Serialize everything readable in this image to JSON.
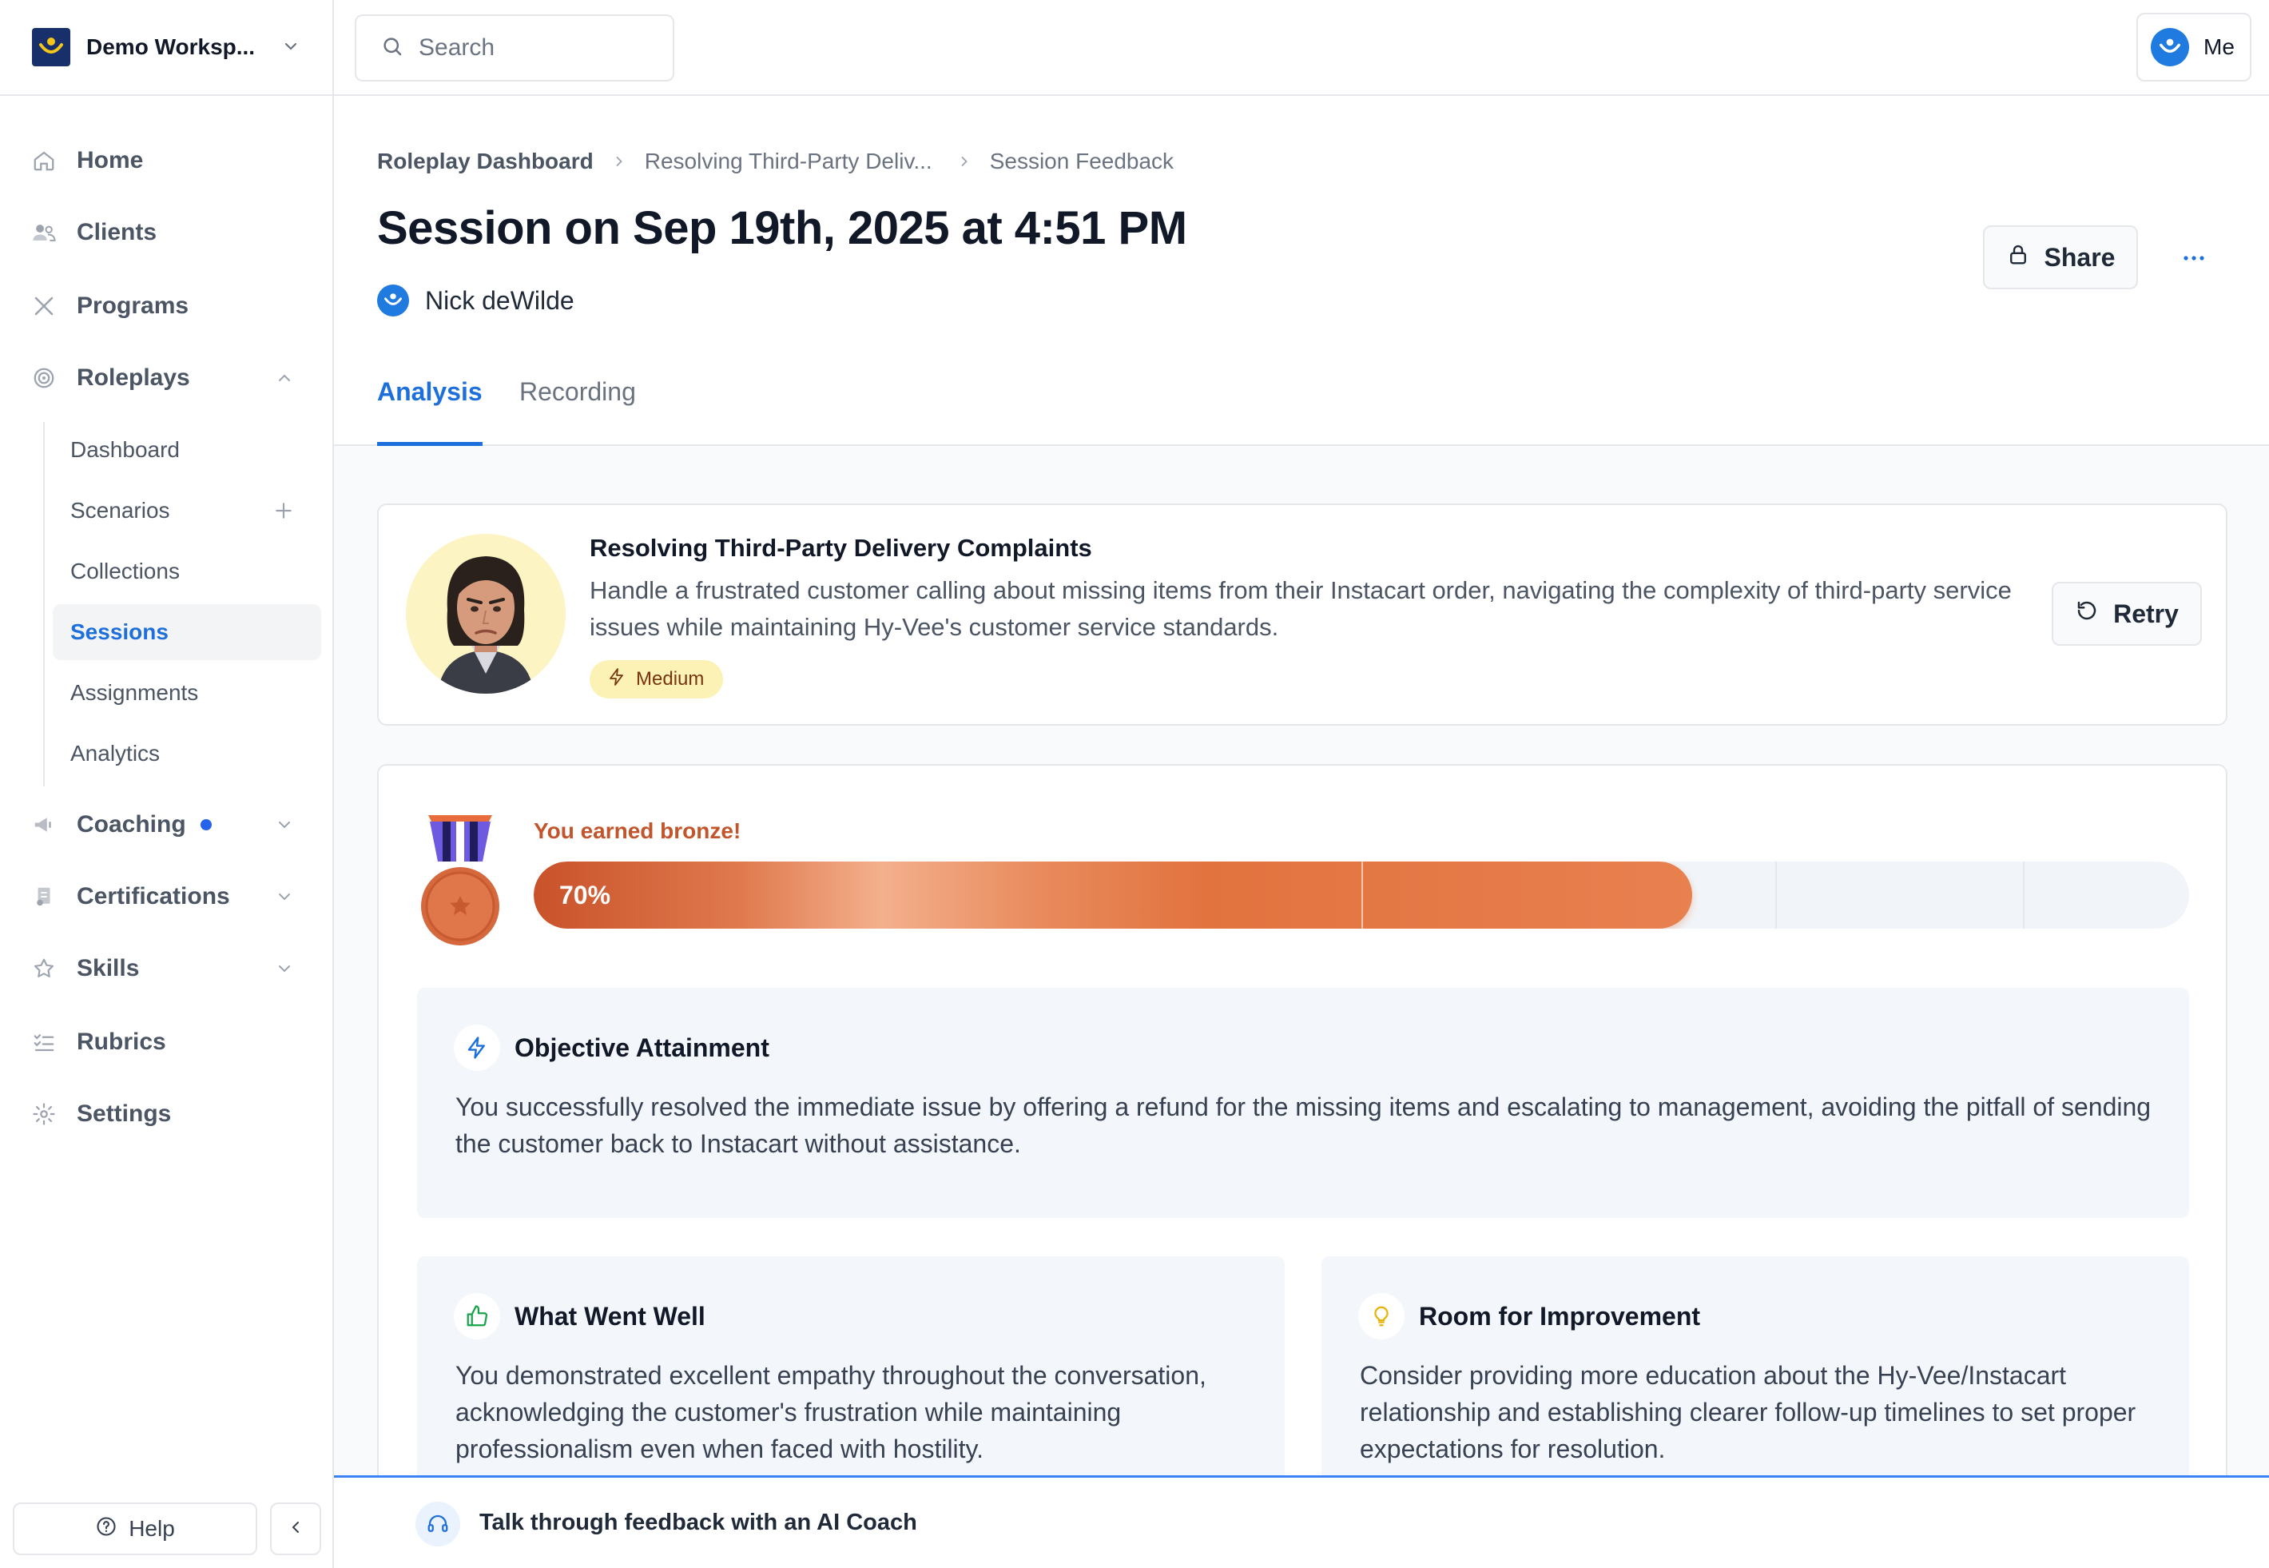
{
  "workspace": {
    "name": "Demo Worksp..."
  },
  "search": {
    "placeholder": "Search"
  },
  "user_menu": {
    "label": "Me"
  },
  "sidebar": {
    "items": [
      {
        "label": "Home",
        "icon": "home-icon"
      },
      {
        "label": "Clients",
        "icon": "users-icon"
      },
      {
        "label": "Programs",
        "icon": "programs-icon"
      },
      {
        "label": "Roleplays",
        "icon": "target-icon",
        "expanded": true
      },
      {
        "label": "Coaching",
        "icon": "megaphone-icon",
        "notification": true
      },
      {
        "label": "Certifications",
        "icon": "certificate-icon"
      },
      {
        "label": "Skills",
        "icon": "star-icon"
      },
      {
        "label": "Rubrics",
        "icon": "list-check-icon"
      },
      {
        "label": "Settings",
        "icon": "gear-icon"
      }
    ],
    "roleplay_sub": [
      {
        "label": "Dashboard"
      },
      {
        "label": "Scenarios"
      },
      {
        "label": "Collections"
      },
      {
        "label": "Sessions",
        "active": true
      },
      {
        "label": "Assignments"
      },
      {
        "label": "Analytics"
      }
    ],
    "help_label": "Help"
  },
  "breadcrumb": [
    "Roleplay Dashboard",
    "Resolving Third-Party Deliv...",
    "Session Feedback"
  ],
  "page": {
    "title": "Session on Sep 19th, 2025 at 4:51 PM",
    "owner": "Nick deWilde",
    "share_label": "Share"
  },
  "tabs": [
    {
      "label": "Analysis",
      "active": true
    },
    {
      "label": "Recording",
      "active": false
    }
  ],
  "scenario": {
    "title": "Resolving Third-Party Delivery Complaints",
    "description": "Handle a frustrated customer calling about missing items from their Instacart order, navigating the complexity of third-party service issues while maintaining Hy-Vee's customer service standards.",
    "difficulty": "Medium",
    "retry_label": "Retry"
  },
  "score": {
    "earned_text": "You earned bronze!",
    "percent_label": "70%",
    "percent": 70,
    "medal": "bronze"
  },
  "feedback": {
    "objective": {
      "title": "Objective Attainment",
      "text": "You successfully resolved the immediate issue by offering a refund for the missing items and escalating to management, avoiding the pitfall of sending the customer back to Instacart without assistance."
    },
    "well": {
      "title": "What Went Well",
      "text": "You demonstrated excellent empathy throughout the conversation, acknowledging the customer's frustration while maintaining professionalism even when faced with hostility."
    },
    "improve": {
      "title": "Room for Improvement",
      "text": "Consider providing more education about the Hy-Vee/Instacart relationship and establishing clearer follow-up timelines to set proper expectations for resolution."
    }
  },
  "coach_bar": {
    "label": "Talk through feedback with an AI Coach"
  },
  "colors": {
    "accent": "#1d6fdc",
    "bronze": "#e2733f",
    "badge_bg": "#fdf2b6"
  }
}
